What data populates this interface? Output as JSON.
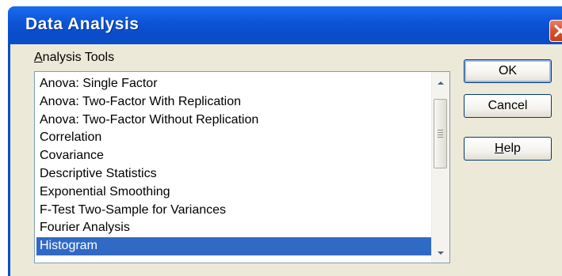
{
  "window": {
    "title": "Data Analysis"
  },
  "group": {
    "label_underlined": "A",
    "label_rest": "nalysis Tools"
  },
  "list": {
    "items": [
      "Anova: Single Factor",
      "Anova: Two-Factor With Replication",
      "Anova: Two-Factor Without Replication",
      "Correlation",
      "Covariance",
      "Descriptive Statistics",
      "Exponential Smoothing",
      "F-Test Two-Sample for Variances",
      "Fourier Analysis",
      "Histogram"
    ],
    "selected": "Histogram"
  },
  "buttons": {
    "ok": "OK",
    "cancel": "Cancel",
    "help_underlined": "H",
    "help_rest": "elp"
  },
  "colors": {
    "titlebar": "#0b4ec8",
    "dialog_bg": "#ece9d8",
    "selection": "#316ac5",
    "close_button": "#d6532e"
  }
}
